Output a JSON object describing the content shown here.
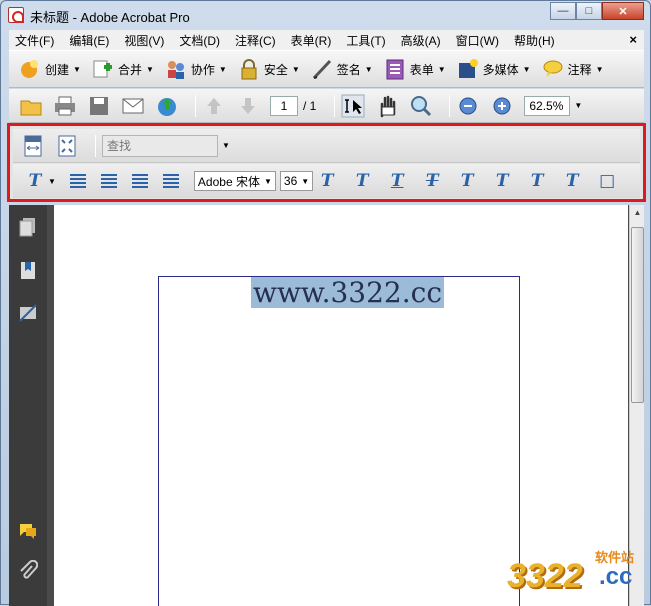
{
  "window": {
    "title": "未标题 - Adobe Acrobat Pro"
  },
  "menu": [
    "文件(F)",
    "编辑(E)",
    "视图(V)",
    "文档(D)",
    "注释(C)",
    "表单(R)",
    "工具(T)",
    "高级(A)",
    "窗口(W)",
    "帮助(H)"
  ],
  "toolbar1": {
    "create": "创建",
    "combine": "合并",
    "collaborate": "协作",
    "secure": "安全",
    "sign": "签名",
    "forms": "表单",
    "multimedia": "多媒体",
    "comment": "注释"
  },
  "toolbar2": {
    "page": "1",
    "page_total": "/ 1",
    "zoom": "62.5%"
  },
  "typewriter": {
    "find_placeholder": "查找",
    "font": "Adobe 宋体",
    "size": "36"
  },
  "document": {
    "text": "www.3322.cc"
  },
  "watermark": {
    "top": "软件站",
    "big": "3322",
    "cc": ".cc"
  }
}
